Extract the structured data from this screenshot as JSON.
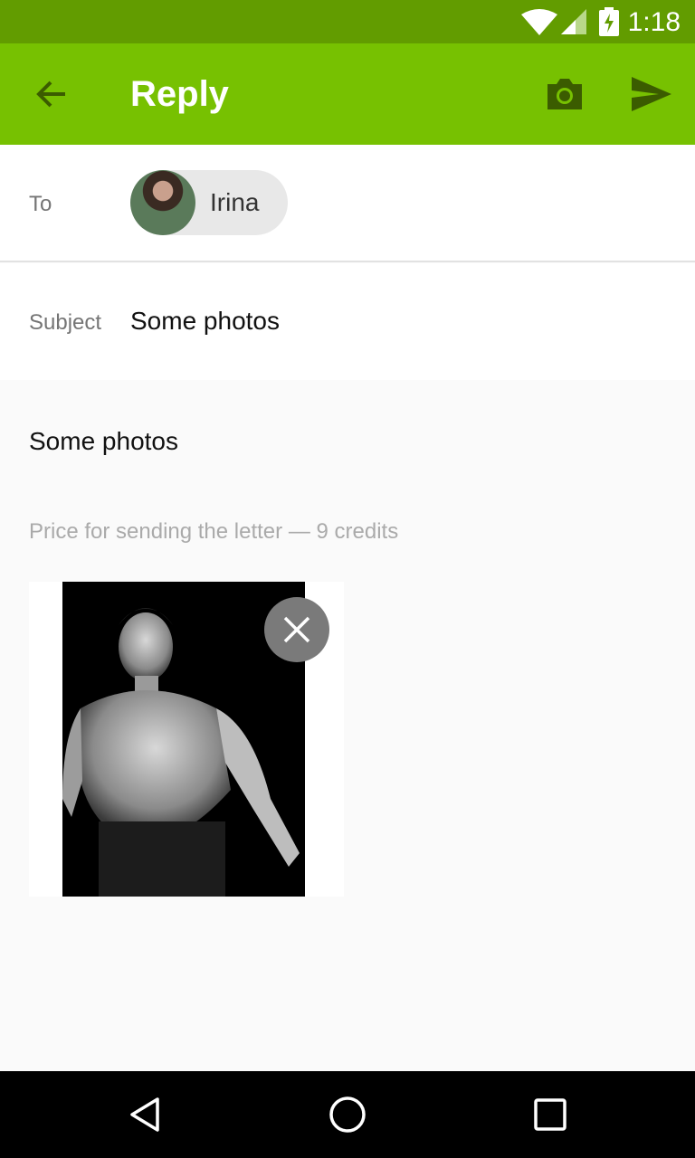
{
  "status_bar": {
    "time": "1:18",
    "icons": [
      "wifi-icon",
      "cell-signal-icon",
      "battery-charging-icon"
    ]
  },
  "app_bar": {
    "title": "Reply",
    "background": "#77c101",
    "status_background": "#629c00",
    "icons": [
      "back-arrow-icon",
      "camera-icon",
      "send-icon"
    ]
  },
  "recipient": {
    "label": "To",
    "name": "Irina"
  },
  "subject": {
    "label": "Subject",
    "value": "Some photos"
  },
  "message": {
    "body": "Some photos",
    "price_note": "Price for sending the letter — 9 credits"
  },
  "attachment": {
    "remove_icon": "close-icon"
  },
  "nav_bar": {
    "icons": [
      "back-triangle-icon",
      "home-circle-icon",
      "recents-square-icon"
    ]
  }
}
